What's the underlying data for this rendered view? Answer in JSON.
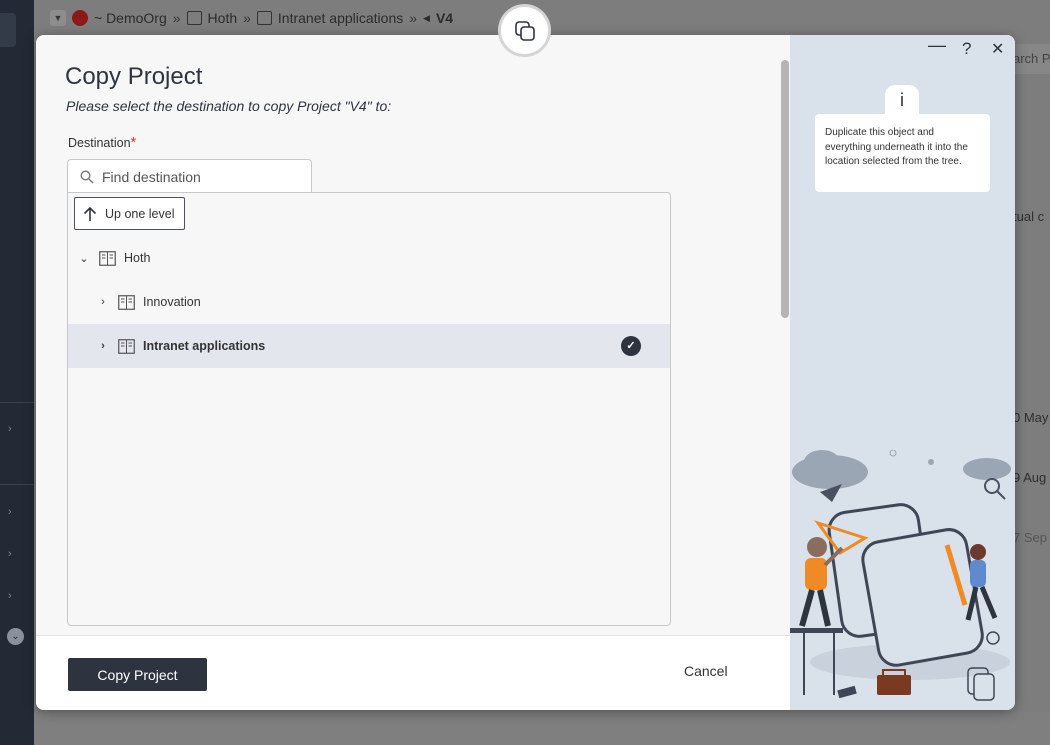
{
  "background": {
    "breadcrumb": {
      "org": "~ DemoOrg",
      "items": [
        "Hoth",
        "Intranet applications"
      ],
      "current": "V4"
    },
    "right_text": [
      "arch P",
      "tual c",
      "0 May",
      "9 Aug",
      "7 Sep"
    ]
  },
  "dialog": {
    "title": "Copy Project",
    "subtitle": "Please select the destination to copy Project \"V4\" to:",
    "destination_label": "Destination",
    "required_marker": "*",
    "search_placeholder": "Find destination",
    "up_level_label": "Up one level",
    "tree": [
      {
        "label": "Hoth",
        "expanded": true,
        "level": 0,
        "selected": false
      },
      {
        "label": "Innovation",
        "expanded": false,
        "level": 1,
        "selected": false
      },
      {
        "label": "Intranet applications",
        "expanded": false,
        "level": 1,
        "selected": true
      }
    ],
    "primary_button": "Copy Project",
    "cancel_button": "Cancel"
  },
  "side_panel": {
    "controls": {
      "minimize": "—",
      "help": "?",
      "close": "✕"
    },
    "tip_icon": "i",
    "tip_text": "Duplicate this object and everything underneath it into the location selected from the tree."
  },
  "colors": {
    "primary": "#2d3440",
    "selected_row": "#e3e6ed",
    "side_panel": "#d9e1ea",
    "accent_orange": "#f08a24"
  },
  "icons": [
    "copy-icon",
    "search-icon",
    "arrow-up-icon",
    "chevron-down-icon",
    "chevron-right-icon",
    "project-icon",
    "check-icon",
    "info-icon"
  ]
}
